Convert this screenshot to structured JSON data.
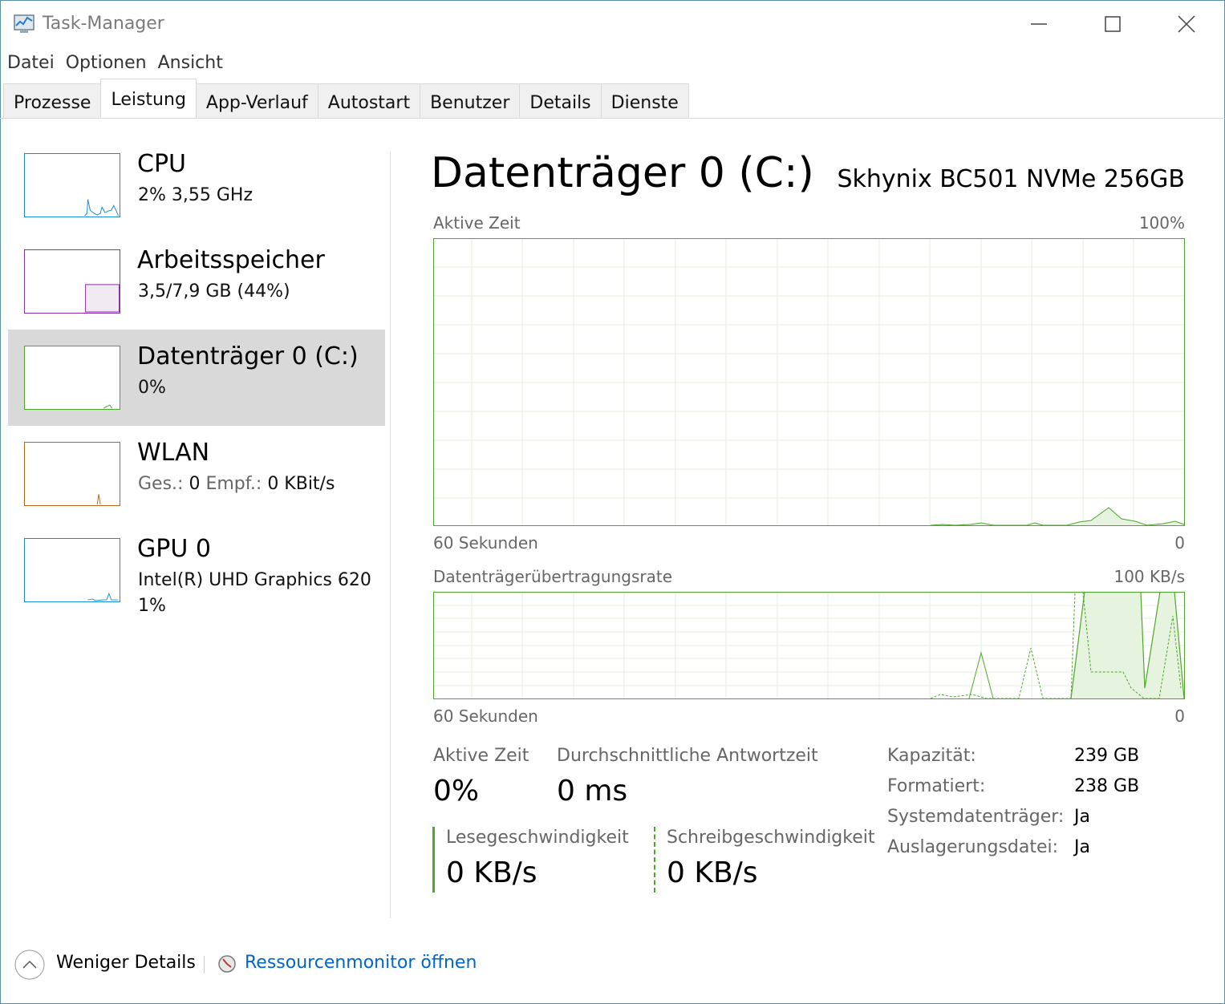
{
  "window": {
    "title": "Task-Manager",
    "icon": "task-manager-icon",
    "controls": [
      "minimize-icon",
      "maximize-icon",
      "close-icon"
    ]
  },
  "menu": [
    "Datei",
    "Optionen",
    "Ansicht"
  ],
  "tabs": [
    "Prozesse",
    "Leistung",
    "App-Verlauf",
    "Autostart",
    "Benutzer",
    "Details",
    "Dienste"
  ],
  "active_tab": "Leistung",
  "sidebar": [
    {
      "title": "CPU",
      "line1": "2%  3,55 GHz",
      "color": "#1a8ad4"
    },
    {
      "title": "Arbeitsspeicher",
      "line1": "3,5/7,9 GB (44%)",
      "color": "#8b2fa8"
    },
    {
      "title": "Datenträger 0 (C:)",
      "line1": "0%",
      "color": "#4ca82a",
      "selected": true
    },
    {
      "title": "WLAN",
      "ges_label": "Ges.:",
      "ges_value": "0",
      "empf_label": "Empf.:",
      "empf_value": "0 KBit/s",
      "color": "#b8651a"
    },
    {
      "title": "GPU 0",
      "line1": "Intel(R) UHD Graphics 620",
      "line2": "1%",
      "color": "#1a8ad4"
    }
  ],
  "detail": {
    "title": "Datenträger 0 (C:)",
    "model": "Skhynix BC501 NVMe 256GB",
    "accent": "#4ca82a",
    "chart1": {
      "label": "Aktive Zeit",
      "max": "100%",
      "time": "60 Sekunden",
      "zero": "0"
    },
    "chart2": {
      "label": "Datenträgerübertragungsrate",
      "max": "100 KB/s",
      "time": "60 Sekunden",
      "zero": "0"
    },
    "stats": {
      "active_time_label": "Aktive Zeit",
      "active_time_value": "0%",
      "response_label": "Durchschnittliche Antwortzeit",
      "response_value": "0 ms",
      "read_label": "Lesegeschwindigkeit",
      "read_value": "0 KB/s",
      "write_label": "Schreibgeschwindigkeit",
      "write_value": "0 KB/s"
    },
    "properties": [
      {
        "label": "Kapazität:",
        "value": "239 GB"
      },
      {
        "label": "Formatiert:",
        "value": "238 GB"
      },
      {
        "label": "Systemdatenträger:",
        "value": "Ja"
      },
      {
        "label": "Auslagerungsdatei:",
        "value": "Ja"
      }
    ]
  },
  "footer": {
    "less_details": "Weniger Details",
    "resource_monitor": "Ressourcenmonitor öffnen",
    "link_color": "#0066cc"
  }
}
